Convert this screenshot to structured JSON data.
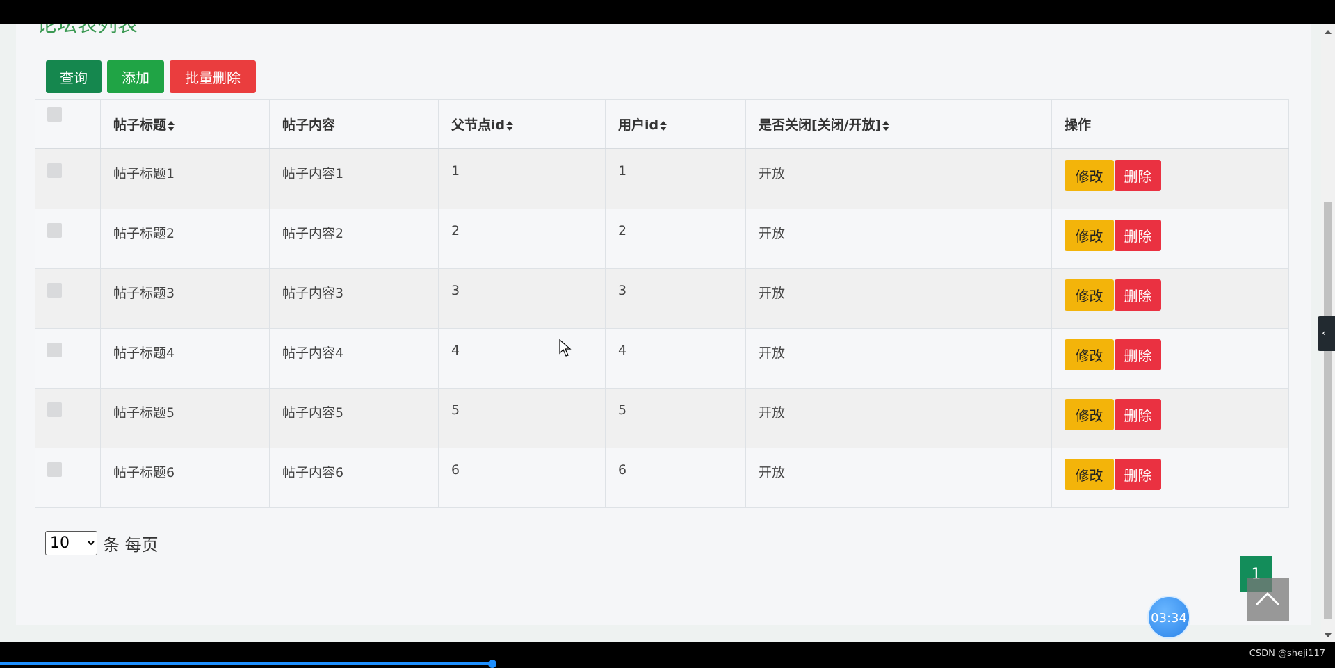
{
  "page": {
    "title": "论坛表列表"
  },
  "toolbar": {
    "query_label": "查询",
    "add_label": "添加",
    "batch_delete_label": "批量删除"
  },
  "table": {
    "columns": [
      {
        "label": "",
        "sortable": false
      },
      {
        "label": "帖子标题",
        "sortable": true
      },
      {
        "label": "帖子内容",
        "sortable": false
      },
      {
        "label": "父节点id",
        "sortable": true
      },
      {
        "label": "用户id",
        "sortable": true
      },
      {
        "label": "是否关闭[关闭/开放]",
        "sortable": true
      },
      {
        "label": "操作",
        "sortable": false
      }
    ],
    "rows": [
      {
        "title": "帖子标题1",
        "content": "帖子内容1",
        "parent_id": "1",
        "user_id": "1",
        "status": "开放"
      },
      {
        "title": "帖子标题2",
        "content": "帖子内容2",
        "parent_id": "2",
        "user_id": "2",
        "status": "开放"
      },
      {
        "title": "帖子标题3",
        "content": "帖子内容3",
        "parent_id": "3",
        "user_id": "3",
        "status": "开放"
      },
      {
        "title": "帖子标题4",
        "content": "帖子内容4",
        "parent_id": "4",
        "user_id": "4",
        "status": "开放"
      },
      {
        "title": "帖子标题5",
        "content": "帖子内容5",
        "parent_id": "5",
        "user_id": "5",
        "status": "开放"
      },
      {
        "title": "帖子标题6",
        "content": "帖子内容6",
        "parent_id": "6",
        "user_id": "6",
        "status": "开放"
      }
    ],
    "edit_label": "修改",
    "delete_label": "删除"
  },
  "pagination": {
    "page_size": "10",
    "page_size_unit": "条 每页",
    "current_page": "1"
  },
  "timer": "03:34",
  "watermark": "CSDN @sheji117",
  "colors": {
    "title_green": "#3c9a54",
    "query_green": "#15874e",
    "add_green": "#20a445",
    "danger_red": "#ea3d3e",
    "warning_yellow": "#f3b40a",
    "page_green": "#138d5a"
  },
  "icons": {
    "sort": "sort-icon",
    "back_to_top": "chevron-up-icon",
    "side_toggle": "chevron-left-icon"
  }
}
